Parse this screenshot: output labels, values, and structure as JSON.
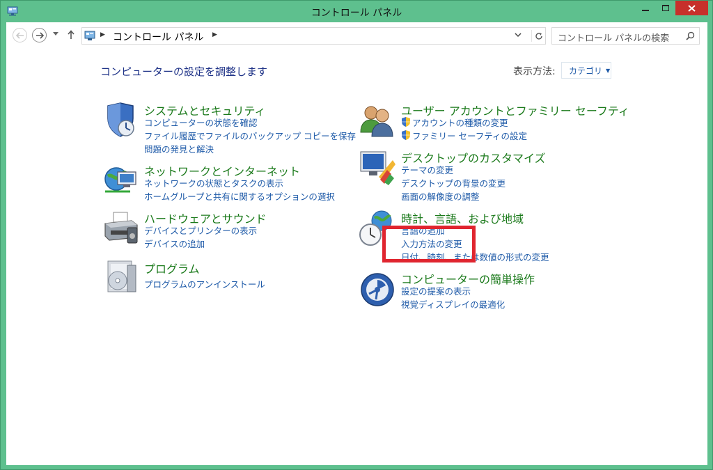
{
  "window": {
    "title": "コントロール パネル"
  },
  "address": {
    "path": "コントロール パネル"
  },
  "search": {
    "placeholder": "コントロール パネルの検索"
  },
  "main": {
    "heading": "コンピューターの設定を調整します",
    "view_label": "表示方法:",
    "view_value": "カテゴリ"
  },
  "categories": [
    {
      "title": "システムとセキュリティ",
      "links": [
        "コンピューターの状態を確認",
        "ファイル履歴でファイルのバックアップ コピーを保存",
        "問題の発見と解決"
      ]
    },
    {
      "title": "ネットワークとインターネット",
      "links": [
        "ネットワークの状態とタスクの表示",
        "ホームグループと共有に関するオプションの選択"
      ]
    },
    {
      "title": "ハードウェアとサウンド",
      "links": [
        "デバイスとプリンターの表示",
        "デバイスの追加"
      ]
    },
    {
      "title": "プログラム",
      "links": [
        "プログラムのアンインストール"
      ]
    },
    {
      "title": "ユーザー アカウントとファミリー セーフティ",
      "links": [
        "アカウントの種類の変更",
        "ファミリー セーフティの設定"
      ]
    },
    {
      "title": "デスクトップのカスタマイズ",
      "links": [
        "テーマの変更",
        "デスクトップの背景の変更",
        "画面の解像度の調整"
      ]
    },
    {
      "title": "時計、言語、および地域",
      "links": [
        "言語の追加",
        "入力方法の変更",
        "日付、時刻、または数値の形式の変更"
      ]
    },
    {
      "title": "コンピューターの簡単操作",
      "links": [
        "設定の提案の表示",
        "視覚ディスプレイの最適化"
      ]
    }
  ]
}
